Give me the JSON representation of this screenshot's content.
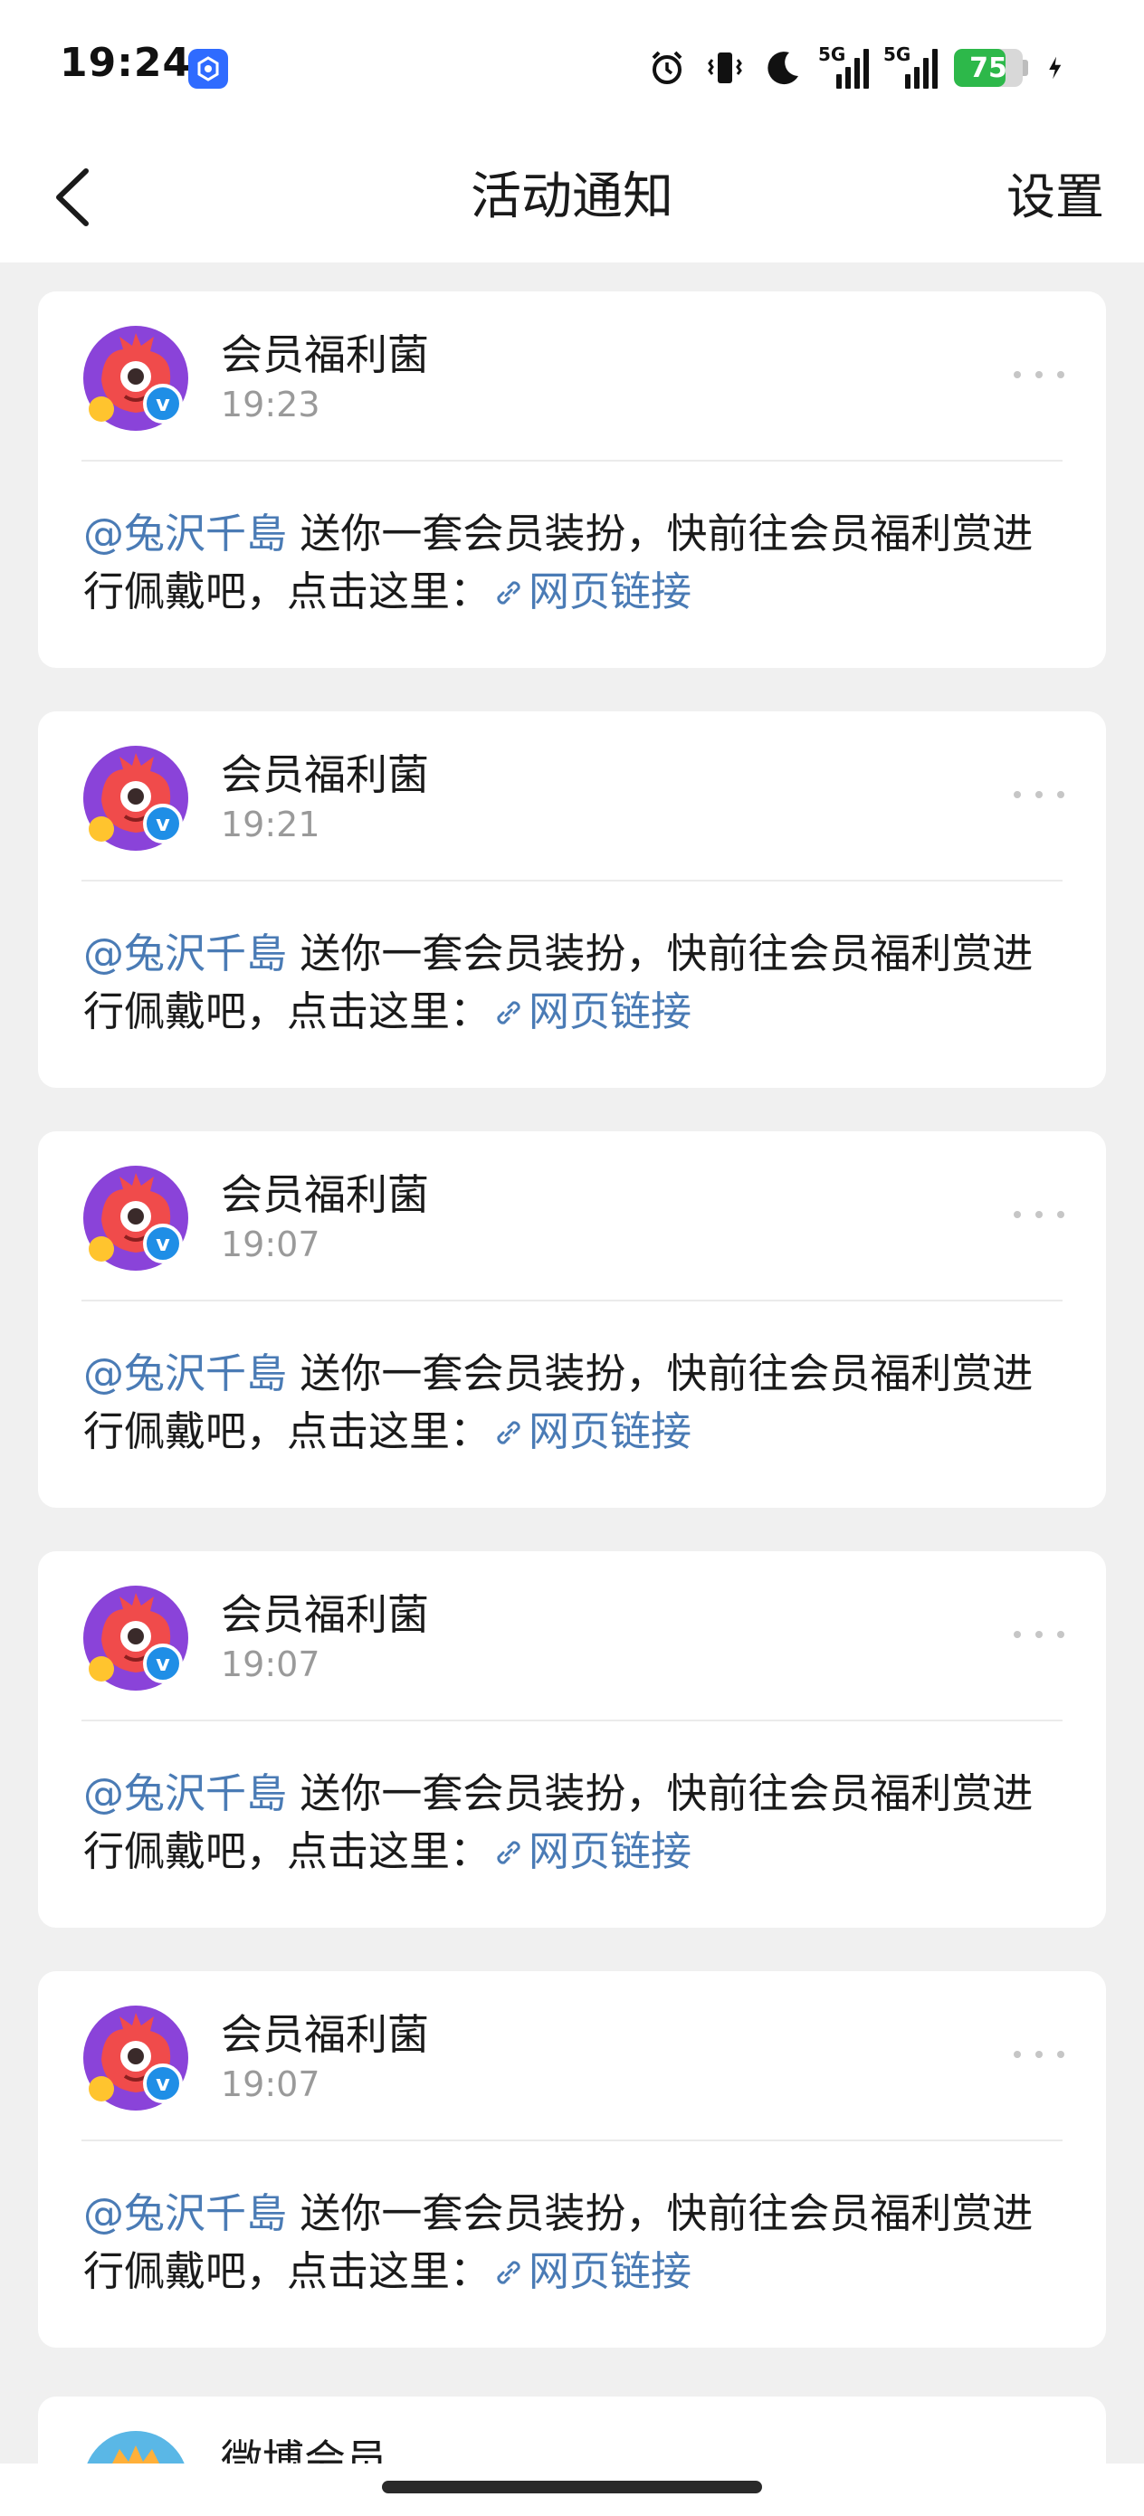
{
  "status_bar": {
    "time": "19:24",
    "battery_level": "75",
    "battery_fraction": 0.75,
    "icons": [
      "app-icon",
      "alarm-icon",
      "vibrate-icon",
      "moon-icon",
      "signal-5g-icon",
      "signal-5g-icon",
      "battery-icon",
      "charging-icon"
    ],
    "signal_tag": "5G"
  },
  "header": {
    "title": "活动通知",
    "settings_label": "设置"
  },
  "notifications": [
    {
      "sender": "会员福利菌",
      "time": "19:23",
      "mention": "@兔沢千島",
      "text": " 送你一套会员装扮，快前往会员福利赏进行佩戴吧，点击这里：",
      "link_label": "网页链接"
    },
    {
      "sender": "会员福利菌",
      "time": "19:21",
      "mention": "@兔沢千島",
      "text": " 送你一套会员装扮，快前往会员福利赏进行佩戴吧，点击这里：",
      "link_label": "网页链接"
    },
    {
      "sender": "会员福利菌",
      "time": "19:07",
      "mention": "@兔沢千島",
      "text": " 送你一套会员装扮，快前往会员福利赏进行佩戴吧，点击这里：",
      "link_label": "网页链接"
    },
    {
      "sender": "会员福利菌",
      "time": "19:07",
      "mention": "@兔沢千島",
      "text": " 送你一套会员装扮，快前往会员福利赏进行佩戴吧，点击这里：",
      "link_label": "网页链接"
    },
    {
      "sender": "会员福利菌",
      "time": "19:07",
      "mention": "@兔沢千島",
      "text": " 送你一套会员装扮，快前往会员福利赏进行佩戴吧，点击这里：",
      "link_label": "网页链接"
    }
  ],
  "partial_notification": {
    "sender": "微博会员"
  },
  "colors": {
    "link": "#4a7bb5",
    "battery": "#2db84a",
    "verified_badge": "#1f8ee6",
    "background": "#f0f0f0"
  }
}
